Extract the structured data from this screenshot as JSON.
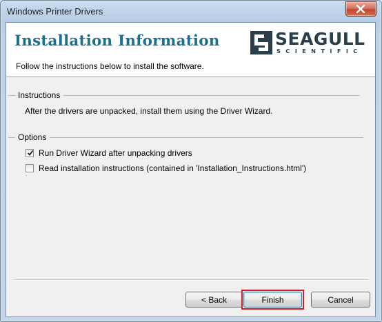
{
  "window": {
    "title": "Windows Printer Drivers"
  },
  "header": {
    "title": "Installation Information",
    "subtitle": "Follow the instructions below to install the software.",
    "logo_main": "SEAGULL",
    "logo_sub": "SCIENTIFIC"
  },
  "instructions": {
    "label": "Instructions",
    "text": "After the drivers are unpacked, install them using the Driver Wizard."
  },
  "options": {
    "label": "Options",
    "items": [
      {
        "label": "Run Driver Wizard after unpacking drivers",
        "checked": true
      },
      {
        "label": "Read installation instructions (contained in 'Installation_Instructions.html')",
        "checked": false
      }
    ]
  },
  "buttons": {
    "back": "< Back",
    "finish": "Finish",
    "cancel": "Cancel"
  },
  "colors": {
    "title_teal": "#1d6f8e",
    "highlight_red": "#d11e2e",
    "logo_dark": "#2a3f4a"
  }
}
